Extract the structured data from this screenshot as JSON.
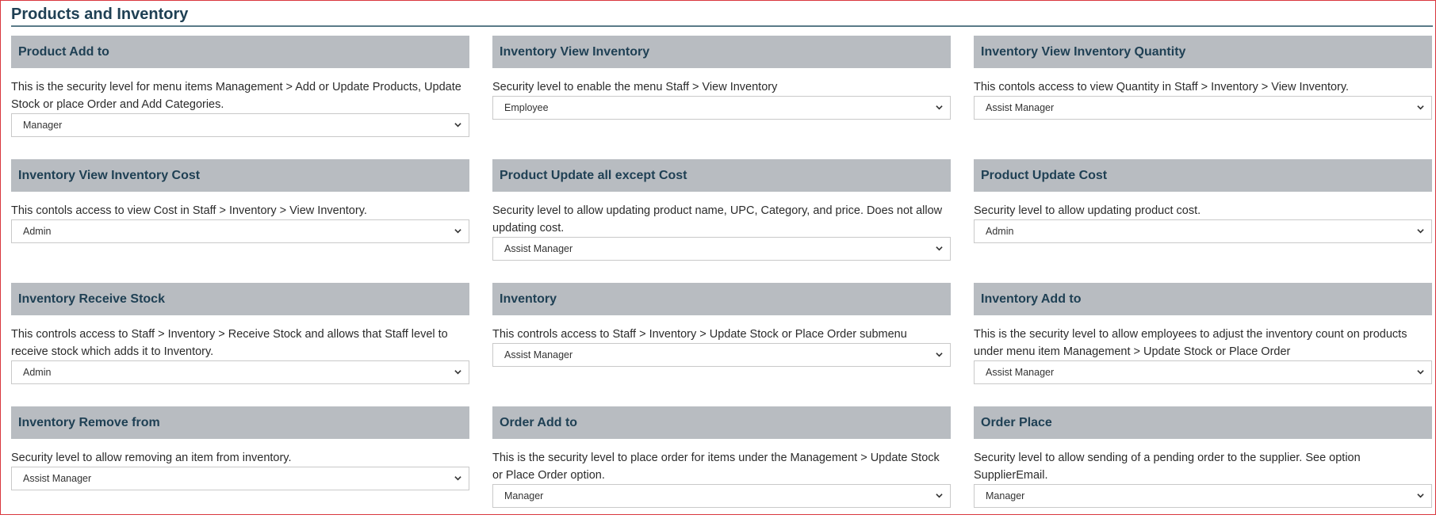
{
  "section": {
    "title": "Products and Inventory"
  },
  "cards": [
    {
      "title": "Product Add to",
      "desc": "This is the security level for menu items Management > Add or Update Products, Update Stock or place Order and Add Categories.",
      "value": "Manager"
    },
    {
      "title": "Inventory View Inventory",
      "desc": "Security level to enable the menu Staff > View Inventory",
      "value": "Employee"
    },
    {
      "title": "Inventory View Inventory Quantity",
      "desc": "This contols access to view Quantity in Staff > Inventory > View Inventory.",
      "value": "Assist Manager"
    },
    {
      "title": "Inventory View Inventory Cost",
      "desc": "This contols access to view Cost in Staff > Inventory > View Inventory.",
      "value": "Admin"
    },
    {
      "title": "Product Update all except Cost",
      "desc": "Security level to allow updating product name, UPC, Category, and price. Does not allow updating cost.",
      "value": "Assist Manager"
    },
    {
      "title": "Product Update Cost",
      "desc": "Security level to allow updating product cost.",
      "value": "Admin"
    },
    {
      "title": "Inventory Receive Stock",
      "desc": "This controls access to Staff > Inventory > Receive Stock and allows that Staff level to receive stock which adds it to Inventory.",
      "value": "Admin"
    },
    {
      "title": "Inventory",
      "desc": "This controls access to Staff > Inventory > Update Stock or Place Order submenu",
      "value": "Assist Manager"
    },
    {
      "title": "Inventory Add to",
      "desc": "This is the security level to allow employees to adjust the inventory count on products under menu item Management > Update Stock or Place Order",
      "value": "Assist Manager"
    },
    {
      "title": "Inventory Remove from",
      "desc": "Security level to allow removing an item from inventory.",
      "value": "Assist Manager"
    },
    {
      "title": "Order Add to",
      "desc": "This is the security level to place order for items under the Management > Update Stock or Place Order option.",
      "value": "Manager"
    },
    {
      "title": "Order Place",
      "desc": "Security level to allow sending of a pending order to the supplier. See option SupplierEmail.",
      "value": "Manager"
    }
  ]
}
